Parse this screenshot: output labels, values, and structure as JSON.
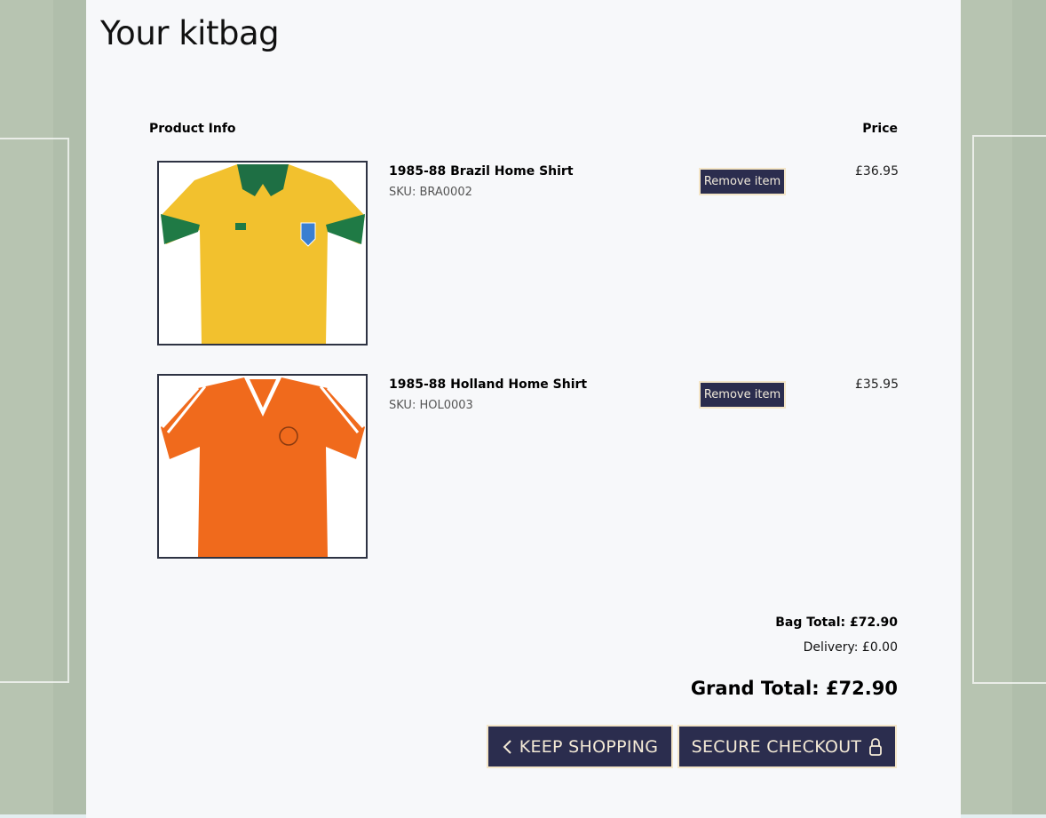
{
  "page": {
    "title": "Your kitbag"
  },
  "table": {
    "product_header": "Product Info",
    "price_header": "Price"
  },
  "items": [
    {
      "name": "1985-88 Brazil Home Shirt",
      "sku": "SKU: BRA0002",
      "remove_label": "Remove item",
      "price": "£36.95",
      "image": "yellow shirt with green collar"
    },
    {
      "name": "1985-88 Holland Home Shirt",
      "sku": "SKU: HOL0003",
      "remove_label": "Remove item",
      "price": "£35.95",
      "image": "orange shirt with white v-neck"
    }
  ],
  "summary": {
    "bag_total": "Bag Total: £72.90",
    "delivery": "Delivery: £0.00",
    "grand_total": "Grand Total: £72.90"
  },
  "actions": {
    "keep_shopping": "KEEP SHOPPING",
    "secure_checkout": "SECURE CHECKOUT"
  },
  "colors": {
    "button_bg": "#2b2d4e",
    "button_border": "#f4e6c8",
    "panel_bg": "#f7f8fa",
    "pitch_bg": "#b4c2ae"
  }
}
